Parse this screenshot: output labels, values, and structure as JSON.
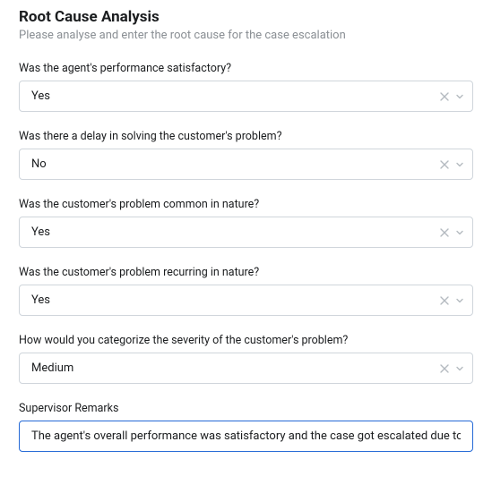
{
  "header": {
    "title": "Root Cause Analysis",
    "subtitle": "Please analyse and enter the root cause for the case escalation"
  },
  "fields": [
    {
      "label": "Was the agent's performance satisfactory?",
      "value": "Yes"
    },
    {
      "label": "Was there a delay in solving the customer's problem?",
      "value": "No"
    },
    {
      "label": "Was the customer's problem common in nature?",
      "value": "Yes"
    },
    {
      "label": "Was the customer's problem recurring in nature?",
      "value": "Yes"
    },
    {
      "label": "How would you categorize the severity of the customer's problem?",
      "value": "Medium"
    }
  ],
  "remarks": {
    "label": "Supervisor Remarks",
    "value": "The agent's overall performance was satisfactory and the case got escalated due to the"
  }
}
